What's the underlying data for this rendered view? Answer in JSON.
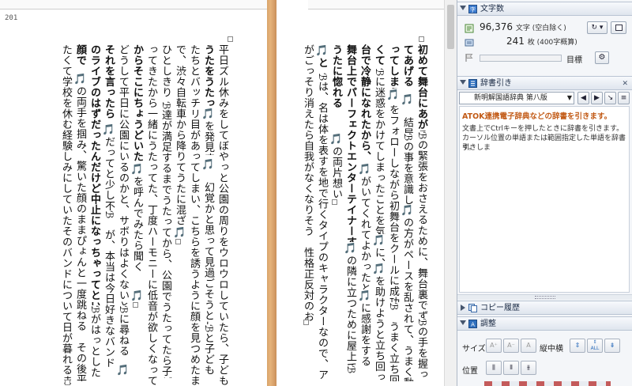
{
  "editor": {
    "page_number": "201",
    "left_columns": [
      "平日ズル休みをしてぼやっと公園の周りをウロウロしていたら、子どもたちに囲まれ",
      "うたをうたっている",
      "🎵を発見する",
      "🎵　幻覚かと思って見過ごそうとしたら、",
      "ℬと子ども",
      "たちとバッチリ目があってしまい、こちらを誘うように顔を見つめたままうたってきたの",
      "で、渋々自転車から降りてうたに混ざりに行く",
      "🎵",
      "ひとしきり",
      "ℬ達が満足するまでうたってから、公園でうたってたら子どもたちが集ま",
      "ってきたから一緒にうたってた、丁度ハーモニーに低音が欲しくなってきたところだった",
      "からそこにちょうどいた",
      "🎵を呼んでみたら聞く",
      "🎵",
      "どうして平日に公園にいるのかと、サボりはよくないといった口ぶりで",
      "ℬに尋ねる",
      "🎵",
      "それを言ったら",
      "🎵だってと少し不服そうな顔をする",
      "ℬ　が、本当は今日好きなバンド",
      "のライブのはずだったんだけど中止になっちゃってという話をする。",
      "ℬがはっとした",
      "顔で",
      "🎵の両手を掴み、驚いた顔のままぴょんと一度跳ねる　その後平日のライブにして",
      "たくて学校を休む経験しみにしていたそのバンドについて日が暮れるまで話し込む"
    ],
    "right_columns": [
      "初めて舞台にあがる",
      "ℬの緊張をおさえるために、舞台裏でずっと",
      "ℬの手を握っておい",
      "てあげる",
      "🎵　結局",
      "ℬの事を意識しすぎた",
      "🎵の方がペースを乱されて、うまく動けなくな",
      "ってしまう",
      "🎵",
      "をフォローしながら初舞台をクールに成功させる",
      "ℬ　うまく立ち回れな",
      "くて",
      "ℬに迷惑をかけてしまったことを気にして謝る",
      "🎵に、",
      "🎵を助けようと立ち回った",
      "台で冷静になれたから、",
      "🎵がいてくれてよかったと",
      "🎵に感謝をする",
      "舞台上でパーフェクトエンターテイナーする",
      "🎵の隣に立つために屋上で練習する",
      "ℬ",
      "うたに惚れる",
      "🎵の両片想い",
      "🎵と",
      "ℬは、名は体を表すを地で行くタイプのキャラクターなので、アイデンティティ",
      "がごっそり消えたら自我がなくなりそう　性格正反対のおうた好きコンビ"
    ]
  },
  "stats_panel": {
    "title": "文字数",
    "char_count": "96,376",
    "char_label": "文字 (空白除く)",
    "page_count": "241",
    "page_label": "枚 (400字概算)",
    "goal_label": "目標"
  },
  "dict_panel": {
    "title": "辞書引き",
    "dictionary": "新明解国語辞典 第八版",
    "link": "ATOK連携電子辞典などの辞書を引きます。",
    "help": [
      "文書上でCtrlキーを押したときに辞書を引きます。",
      "カーソル位置の単語または範囲指定した単語を辞書引きしま",
      "す。"
    ]
  },
  "history_panel": {
    "title": "コピー履歴"
  },
  "adjust_panel": {
    "title": "調整",
    "size_label": "サイズ",
    "tate_label": "縦中横",
    "pos_label": "位置",
    "all_label": "ALL"
  },
  "colors": {
    "accent": "#2f6fbd",
    "link": "#c25a16",
    "gutter": "#d9a46a"
  },
  "icons": [
    "chevron-down-icon",
    "stats-icon",
    "dictionary-icon",
    "history-icon",
    "adjust-icon",
    "flag-icon",
    "gear-icon",
    "refresh-icon"
  ]
}
